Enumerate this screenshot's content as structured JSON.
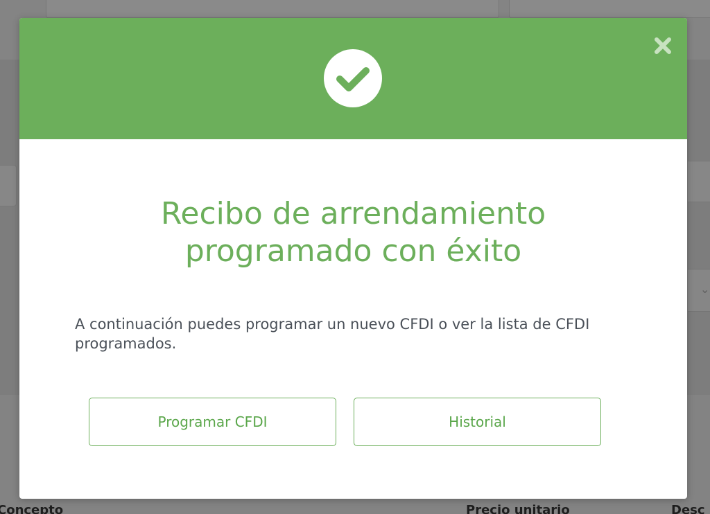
{
  "background": {
    "columns": [
      "Concepto",
      "Precio unitario",
      "Desc"
    ]
  },
  "modal": {
    "header_color": "#6caf5b",
    "icons": {
      "success": "check-circle-icon",
      "close": "close-icon"
    },
    "title_line1": "Recibo de arrendamiento",
    "title_line2": "programado con éxito",
    "message": "A continuación puedes programar un nuevo CFDI o ver la lista de CFDI programados.",
    "buttons": {
      "program_label": "Programar CFDI",
      "history_label": "Historial"
    }
  }
}
